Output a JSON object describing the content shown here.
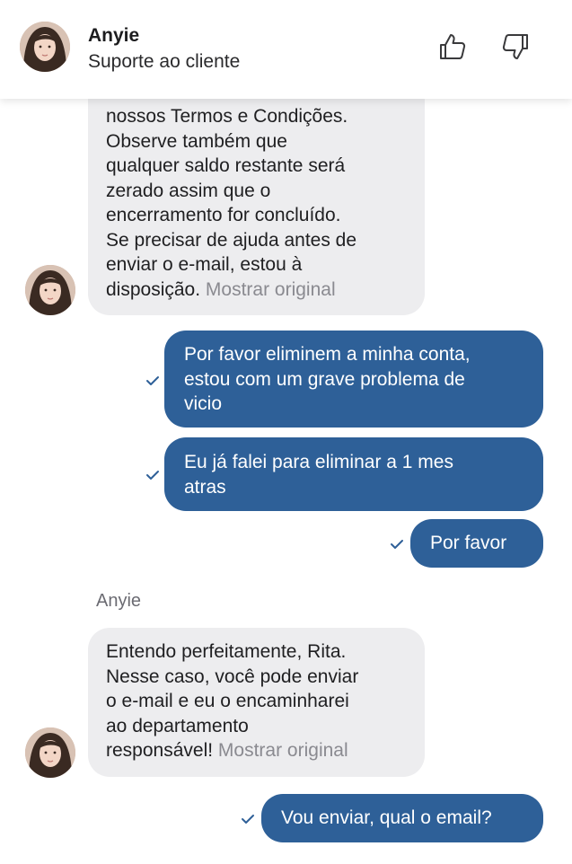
{
  "header": {
    "agent_name": "Anyie",
    "agent_role": "Suporte ao cliente",
    "icons": [
      "thumbs-up-icon",
      "thumbs-down-icon"
    ]
  },
  "messages": {
    "msg1": {
      "lines": [
        "nossos Termos e Condições.",
        "Observe também que",
        "qualquer saldo restante será",
        "zerado assim que o",
        "encerramento for concluído.",
        "Se precisar de ajuda antes de",
        "enviar o e-mail, estou à"
      ],
      "last_line": "disposição.",
      "show_original": "Mostrar original"
    },
    "msg2": {
      "lines": [
        "Por favor eliminem a minha conta,",
        "estou com um grave problema de",
        "vicio"
      ]
    },
    "msg3": {
      "lines": [
        "Eu já falei para eliminar a 1 mes",
        "atras"
      ]
    },
    "msg4": {
      "text": "Por favor"
    },
    "sender_label": "Anyie",
    "msg5": {
      "lines": [
        "Entendo perfeitamente, Rita.",
        "Nesse caso, você pode enviar",
        "o e-mail e eu o encaminharei",
        "ao departamento"
      ],
      "last_line": "responsável!",
      "show_original": "Mostrar original"
    },
    "msg6": {
      "text": "Vou enviar, qual o email?"
    }
  },
  "colors": {
    "outgoing_bubble": "#2e6098",
    "incoming_bubble": "#ededef",
    "check": "#2e6098"
  }
}
